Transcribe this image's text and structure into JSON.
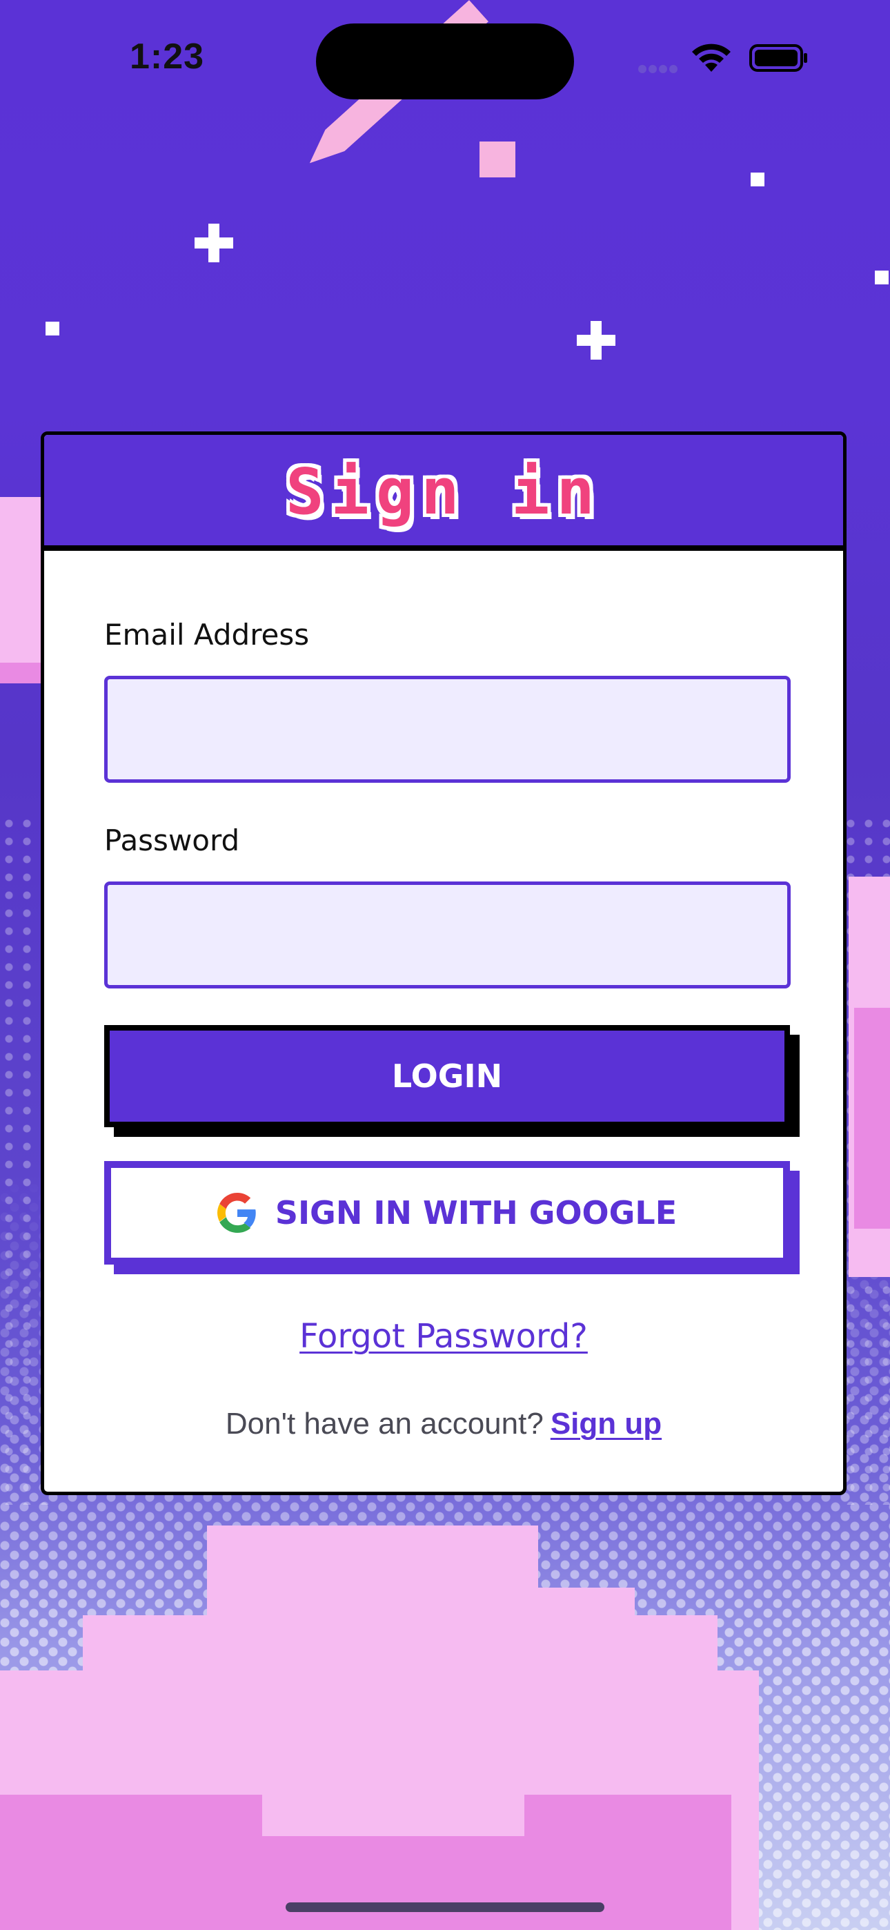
{
  "status_bar": {
    "time": "1:23"
  },
  "card": {
    "title": "Sign in",
    "email": {
      "label": "Email Address",
      "value": "",
      "placeholder": ""
    },
    "password": {
      "label": "Password",
      "value": "",
      "placeholder": ""
    },
    "login_label": "LOGIN",
    "google_label": "SIGN IN WITH GOOGLE",
    "forgot_label": "Forgot Password?",
    "signup_prompt": "Don't have an account?",
    "signup_label": "Sign up"
  },
  "colors": {
    "accent": "#5b32d6",
    "title": "#f0427e",
    "input_bg": "#efecff",
    "cloud": "#f6bbf1"
  },
  "icons": [
    "wifi-icon",
    "battery-icon",
    "google-icon",
    "shooting-star",
    "star-icon"
  ]
}
